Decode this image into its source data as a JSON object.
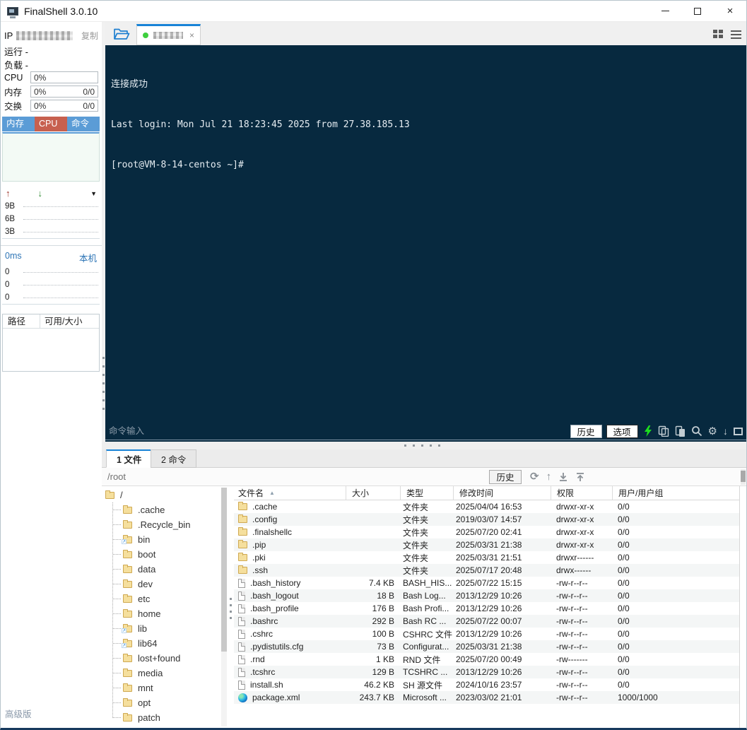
{
  "glyphs": {
    "close": "×",
    "tab_close": "×",
    "sort_asc": "▲",
    "dropdown": "▼",
    "up_arrow": "↑",
    "down_arrow": "↓",
    "refresh": "⟳",
    "gear": "⚙",
    "sym": "↗"
  },
  "window": {
    "title": "FinalShell 3.0.10"
  },
  "sidebar": {
    "ip_label": "IP",
    "copy_label": "复制",
    "run_label": "运行 -",
    "load_label": "负载 -",
    "cpu": {
      "label": "CPU",
      "usage": "0%"
    },
    "memory": {
      "label": "内存",
      "usage": "0%",
      "ratio": "0/0"
    },
    "swap": {
      "label": "交换",
      "usage": "0%",
      "ratio": "0/0"
    },
    "monitor_tabs": [
      "内存",
      "CPU",
      "命令"
    ],
    "net_chart": {
      "ticks": [
        "9B",
        "6B",
        "3B"
      ]
    },
    "ping": {
      "latency": "0ms",
      "host": "本机",
      "ticks": [
        "0",
        "0",
        "0"
      ]
    },
    "disk_table": {
      "headers": [
        "路径",
        "可用/大小"
      ]
    },
    "edition": "高级版"
  },
  "terminal": {
    "lines": [
      "连接成功",
      "Last login: Mon Jul 21 18:23:45 2025 from 27.38.185.13",
      "[root@VM-8-14-centos ~]#"
    ],
    "toolbar": {
      "input_placeholder": "命令输入",
      "history_label": "历史",
      "options_label": "选项"
    }
  },
  "bottom": {
    "tabs": [
      "1 文件",
      "2 命令"
    ],
    "path": "/root",
    "history_label": "历史",
    "tree": {
      "root": "/",
      "items": [
        {
          "label": ".cache"
        },
        {
          "label": ".Recycle_bin"
        },
        {
          "label": "bin",
          "symlink": true
        },
        {
          "label": "boot"
        },
        {
          "label": "data"
        },
        {
          "label": "dev"
        },
        {
          "label": "etc"
        },
        {
          "label": "home"
        },
        {
          "label": "lib",
          "symlink": true
        },
        {
          "label": "lib64",
          "symlink": true
        },
        {
          "label": "lost+found"
        },
        {
          "label": "media"
        },
        {
          "label": "mnt"
        },
        {
          "label": "opt"
        },
        {
          "label": "patch"
        }
      ]
    },
    "table": {
      "headers": [
        "文件名",
        "大小",
        "类型",
        "修改时间",
        "权限",
        "用户/用户组"
      ],
      "rows": [
        {
          "icon": "folder",
          "name": ".cache",
          "size": "",
          "type": "文件夹",
          "mtime": "2025/04/04 16:53",
          "perm": "drwxr-xr-x",
          "owner": "0/0"
        },
        {
          "icon": "folder",
          "name": ".config",
          "size": "",
          "type": "文件夹",
          "mtime": "2019/03/07 14:57",
          "perm": "drwxr-xr-x",
          "owner": "0/0"
        },
        {
          "icon": "folder",
          "name": ".finalshellc",
          "size": "",
          "type": "文件夹",
          "mtime": "2025/07/20 02:41",
          "perm": "drwxr-xr-x",
          "owner": "0/0"
        },
        {
          "icon": "folder",
          "name": ".pip",
          "size": "",
          "type": "文件夹",
          "mtime": "2025/03/31 21:38",
          "perm": "drwxr-xr-x",
          "owner": "0/0"
        },
        {
          "icon": "folder",
          "name": ".pki",
          "size": "",
          "type": "文件夹",
          "mtime": "2025/03/31 21:51",
          "perm": "drwxr------",
          "owner": "0/0"
        },
        {
          "icon": "folder",
          "name": ".ssh",
          "size": "",
          "type": "文件夹",
          "mtime": "2025/07/17 20:48",
          "perm": "drwx------",
          "owner": "0/0"
        },
        {
          "icon": "file",
          "name": ".bash_history",
          "size": "7.4 KB",
          "type": "BASH_HIS...",
          "mtime": "2025/07/22 15:15",
          "perm": "-rw-r--r--",
          "owner": "0/0"
        },
        {
          "icon": "file",
          "name": ".bash_logout",
          "size": "18 B",
          "type": "Bash Log...",
          "mtime": "2013/12/29 10:26",
          "perm": "-rw-r--r--",
          "owner": "0/0"
        },
        {
          "icon": "file",
          "name": ".bash_profile",
          "size": "176 B",
          "type": "Bash Profi...",
          "mtime": "2013/12/29 10:26",
          "perm": "-rw-r--r--",
          "owner": "0/0"
        },
        {
          "icon": "file",
          "name": ".bashrc",
          "size": "292 B",
          "type": "Bash RC ...",
          "mtime": "2025/07/22 00:07",
          "perm": "-rw-r--r--",
          "owner": "0/0"
        },
        {
          "icon": "file",
          "name": ".cshrc",
          "size": "100 B",
          "type": "CSHRC 文件",
          "mtime": "2013/12/29 10:26",
          "perm": "-rw-r--r--",
          "owner": "0/0"
        },
        {
          "icon": "file",
          "name": ".pydistutils.cfg",
          "size": "73 B",
          "type": "Configurat...",
          "mtime": "2025/03/31 21:38",
          "perm": "-rw-r--r--",
          "owner": "0/0"
        },
        {
          "icon": "file",
          "name": ".rnd",
          "size": "1 KB",
          "type": "RND 文件",
          "mtime": "2025/07/20 00:49",
          "perm": "-rw-------",
          "owner": "0/0"
        },
        {
          "icon": "file",
          "name": ".tcshrc",
          "size": "129 B",
          "type": "TCSHRC ...",
          "mtime": "2013/12/29 10:26",
          "perm": "-rw-r--r--",
          "owner": "0/0"
        },
        {
          "icon": "file",
          "name": "install.sh",
          "size": "46.2 KB",
          "type": "SH 源文件",
          "mtime": "2024/10/16 23:57",
          "perm": "-rw-r--r--",
          "owner": "0/0"
        },
        {
          "icon": "edge",
          "name": "package.xml",
          "size": "243.7 KB",
          "type": "Microsoft ...",
          "mtime": "2023/03/02 21:01",
          "perm": "-rw-r--r--",
          "owner": "1000/1000"
        }
      ]
    }
  }
}
